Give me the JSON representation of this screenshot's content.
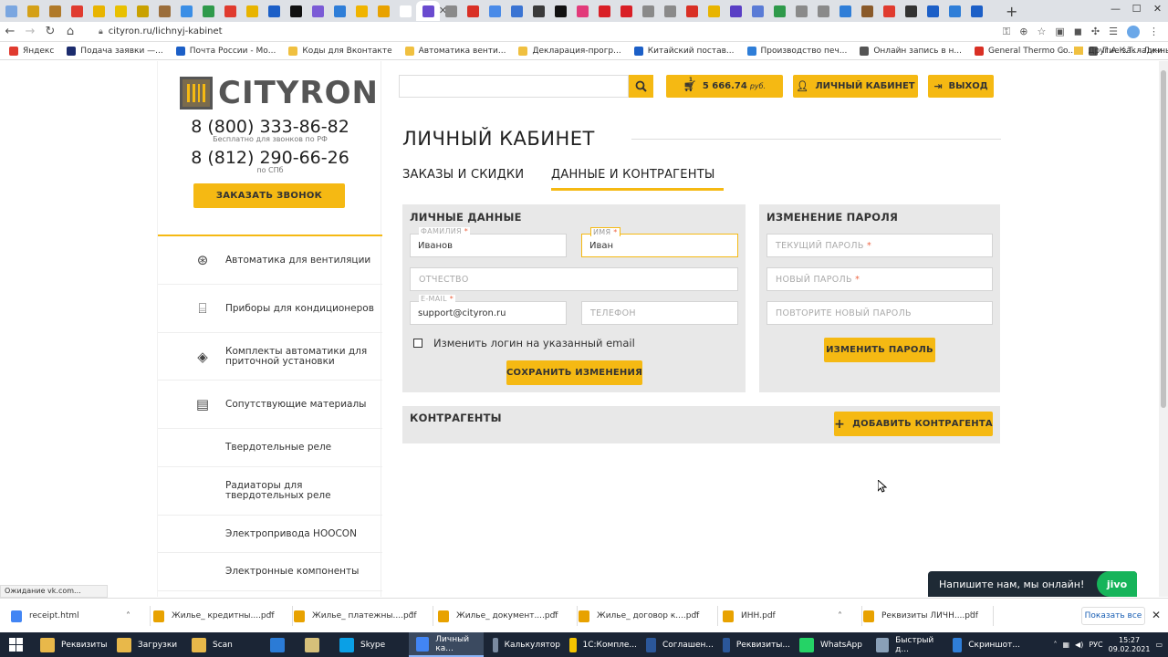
{
  "browser": {
    "favicon_colors": [
      "#7aa6e0",
      "#d4a017",
      "#b07a2a",
      "#e03b2f",
      "#e8b400",
      "#e8c000",
      "#c9a100",
      "#9b6e3c",
      "#3a8ee6",
      "#2f9a4b",
      "#e03b2f",
      "#e8b400",
      "#1c5fc7",
      "#111111",
      "#7b5bd6",
      "#2f7ed8",
      "#f0b400",
      "#e8a200",
      "#ffffff",
      "#6a4bcf",
      "#8a8a8a",
      "#d93025",
      "#4a8be8",
      "#3a74d3",
      "#3a3a3a",
      "#111111",
      "#e23a7a",
      "#d91f26",
      "#d91f26",
      "#8a8a8a",
      "#8a8a8a",
      "#d93025",
      "#e8b400",
      "#5a3fc5",
      "#5a7bd6",
      "#2f9a4b",
      "#8a8a8a",
      "#8a8a8a",
      "#2f7ed8",
      "#8a5a2a",
      "#e03b2f",
      "#333333",
      "#1c5fc7",
      "#2f7ed8",
      "#1c5fc7"
    ],
    "url": "cityron.ru/lichnyj-kabinet",
    "bookmarks": [
      {
        "label": "Яндекс",
        "color": "#e03b2f"
      },
      {
        "label": "Подача заявки —...",
        "color": "#1c2c6e"
      },
      {
        "label": "Почта России - Мо...",
        "color": "#1c5fc7"
      },
      {
        "label": "Коды для Вконтакте",
        "color": "#f0c040"
      },
      {
        "label": "Автоматика венти...",
        "color": "#f0c040"
      },
      {
        "label": "Декларация-прогр...",
        "color": "#f0c040"
      },
      {
        "label": "Китайский постав...",
        "color": "#1c5fc7"
      },
      {
        "label": "Производство печ...",
        "color": "#2f7ed8"
      },
      {
        "label": "Онлайн запись в н...",
        "color": "#555555"
      },
      {
        "label": "General Thermo Co...",
        "color": "#d93025"
      },
      {
        "label": "П.А.К.Т. - Личный к...",
        "color": "#555555"
      }
    ],
    "other_bookmarks": "Другие закладки"
  },
  "site": {
    "logo_text": "CITYRON",
    "phone1": "8 (800) 333-86-82",
    "phone1_note": "Бесплатно для звонков по РФ",
    "phone2": "8 (812) 290-66-26",
    "phone2_note": "по СПб",
    "call_button": "ЗАКАЗАТЬ ЗВОНОК",
    "menu": [
      {
        "label": "Автоматика для вентиляции",
        "icon": "⊛"
      },
      {
        "label": "Приборы для кондиционеров",
        "icon": "⌸"
      },
      {
        "label": "Комплекты автоматики для приточной установки",
        "icon": "◈"
      },
      {
        "label": "Сопутствующие материалы",
        "icon": "▤"
      },
      {
        "label": "Твердотельные реле",
        "icon": ""
      },
      {
        "label": "Радиаторы для твердотельных реле",
        "icon": ""
      },
      {
        "label": "Электропривода HOOCON",
        "icon": ""
      },
      {
        "label": "Электронные компоненты",
        "icon": ""
      }
    ],
    "search_placeholder": "",
    "cart_amount": "5 666.74",
    "cart_currency": "руб.",
    "cart_count": "1",
    "cabinet_button": "ЛИЧНЫЙ КАБИНЕТ",
    "logout_button": "ВЫХОД"
  },
  "main": {
    "title": "ЛИЧНЫЙ КАБИНЕТ",
    "tabs": [
      "ЗАКАЗЫ И СКИДКИ",
      "ДАННЫЕ И КОНТРАГЕНТЫ"
    ],
    "personal": {
      "title": "ЛИЧНЫЕ ДАННЫЕ",
      "surname_label": "ФАМИЛИЯ",
      "surname_value": "Иванов",
      "name_label": "ИМЯ",
      "name_value": "Иван",
      "patronymic_placeholder": "ОТЧЕСТВО",
      "email_label": "E-MAIL",
      "email_value": "support@cityron.ru",
      "phone_placeholder": "ТЕЛЕФОН",
      "checkbox_label": "Изменить логин на указанный email",
      "save_button": "СОХРАНИТЬ ИЗМЕНЕНИЯ",
      "required_mark": "*"
    },
    "password": {
      "title": "ИЗМЕНЕНИЕ ПАРОЛЯ",
      "current_placeholder": "ТЕКУЩИЙ ПАРОЛЬ",
      "new_placeholder": "НОВЫЙ ПАРОЛЬ",
      "repeat_placeholder": "ПОВТОРИТЕ НОВЫЙ ПАРОЛЬ",
      "change_button": "ИЗМЕНИТЬ ПАРОЛЬ"
    },
    "contractors": {
      "title": "КОНТРАГЕНТЫ",
      "add_button": "ДОБАВИТЬ КОНТРАГЕНТА"
    }
  },
  "chat": {
    "text": "Напишите нам, мы онлайн!",
    "brand": "jivo"
  },
  "status_text": "Ожидание vk.com...",
  "downloads": {
    "items": [
      {
        "name": "receipt.html",
        "color": "#4285f4"
      },
      {
        "name": "Жилье_ кредитны....pdf",
        "color": "#e8a200"
      },
      {
        "name": "Жилье_ платежны....pdf",
        "color": "#e8a200"
      },
      {
        "name": "Жилье_ документ....pdf",
        "color": "#e8a200"
      },
      {
        "name": "Жилье_ договор к....pdf",
        "color": "#e8a200"
      },
      {
        "name": "ИНН.pdf",
        "color": "#e8a200"
      },
      {
        "name": "Реквизиты ЛИЧН....pdf",
        "color": "#e8a200"
      }
    ],
    "show_all": "Показать все"
  },
  "taskbar": {
    "items": [
      {
        "label": "Реквизиты",
        "color": "#e8b84a"
      },
      {
        "label": "Загрузки",
        "color": "#e8b84a"
      },
      {
        "label": "Scan",
        "color": "#e8b84a"
      },
      {
        "label": "",
        "color": "#2b7bd6"
      },
      {
        "label": "",
        "color": "#d6c07a"
      },
      {
        "label": "Skype",
        "color": "#0aa0e6"
      },
      {
        "label": "Личный ка...",
        "color": "#4285f4"
      },
      {
        "label": "Калькулятор",
        "color": "#7a8aa0"
      },
      {
        "label": "1С:Компле...",
        "color": "#f5c400"
      },
      {
        "label": "Соглашен...",
        "color": "#2b579a"
      },
      {
        "label": "Реквизиты...",
        "color": "#2b579a"
      },
      {
        "label": "WhatsApp",
        "color": "#25d366"
      },
      {
        "label": "Быстрый д...",
        "color": "#8aa0b8"
      },
      {
        "label": "Скриншот...",
        "color": "#2f7ed8"
      }
    ],
    "lang": "РУС",
    "time": "15:27",
    "date": "09.02.2021"
  }
}
